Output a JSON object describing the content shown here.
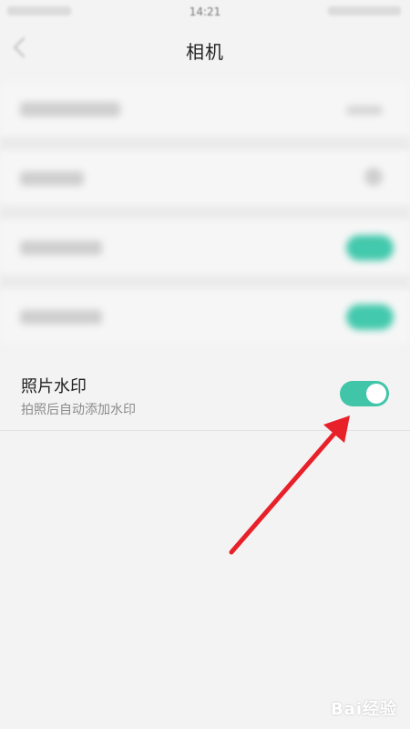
{
  "status_bar": {
    "time": "14:21"
  },
  "header": {
    "title": "相机"
  },
  "setting": {
    "title": "照片水印",
    "subtitle": "拍照后自动添加水印",
    "enabled": true
  },
  "colors": {
    "toggle_on": "#41c5a8",
    "arrow": "#e8202a"
  },
  "icons": {
    "back": "back-arrow-icon"
  },
  "watermark": {
    "text": "Bai经验"
  }
}
